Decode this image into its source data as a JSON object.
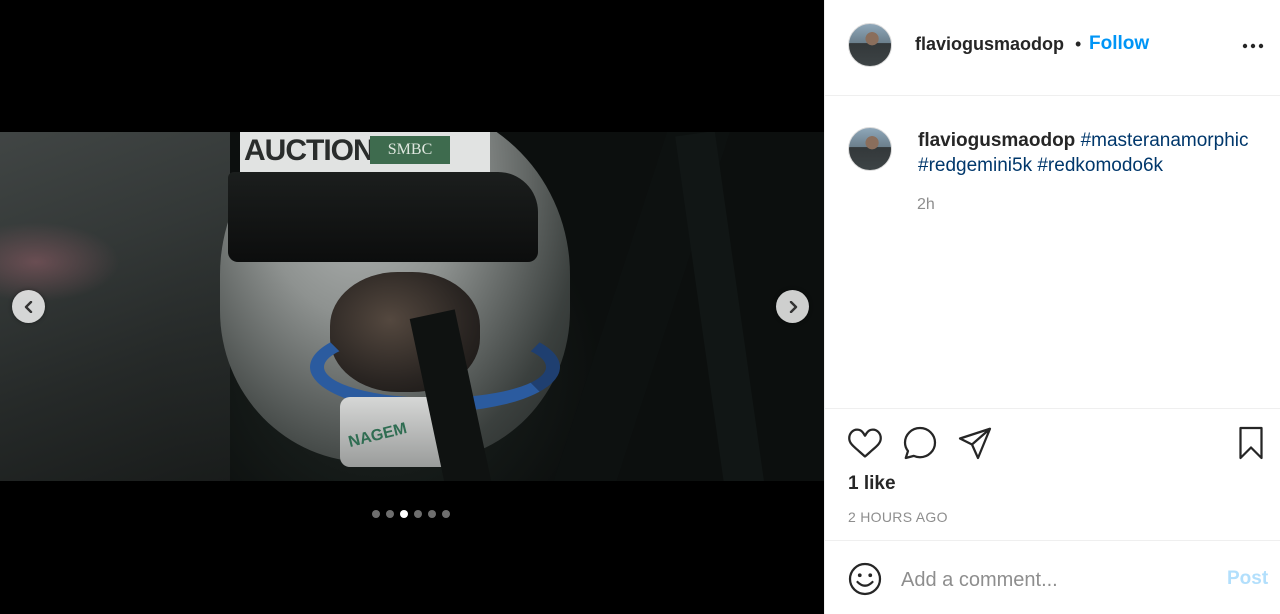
{
  "post": {
    "username": "flaviogusmaodop",
    "follow_label": "Follow",
    "separator": "•",
    "caption": {
      "username": "flaviogusmaodop",
      "hashtags": [
        "#masteranamorphic",
        "#redgemini5k",
        "#redkomodo6k"
      ],
      "time": "2h"
    },
    "likes": "1 like",
    "posted_ago": "2 HOURS AGO"
  },
  "media": {
    "carousel": {
      "count": 6,
      "active_index": 2
    },
    "photo_text": {
      "strip": "AUCTION",
      "sponsor": "SMBC",
      "collar": "NAGEM"
    }
  },
  "comment": {
    "placeholder": "Add a comment...",
    "post_label": "Post"
  },
  "icons": {
    "prev": "chevron-left-icon",
    "next": "chevron-right-icon",
    "more": "more-horizontal-icon",
    "like": "heart-icon",
    "comment": "comment-bubble-icon",
    "share": "paper-plane-icon",
    "save": "bookmark-icon",
    "emoji": "smiley-icon"
  },
  "colors": {
    "link_blue": "#0095f6",
    "hashtag": "#00376b",
    "post_disabled": "#b2dffc"
  }
}
